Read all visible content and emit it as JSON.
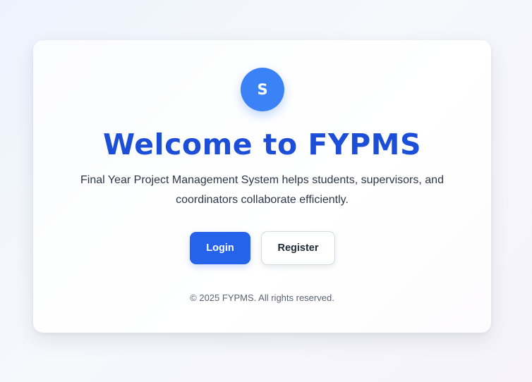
{
  "brand": {
    "avatar_letter": "S",
    "title": "Welcome to FYPMS",
    "description": "Final Year Project Management System helps students, supervisors, and coordinators collaborate efficiently."
  },
  "actions": {
    "login_label": "Login",
    "register_label": "Register"
  },
  "footer": {
    "copyright": "© 2025 FYPMS. All rights reserved."
  },
  "colors": {
    "primary": "#2563eb",
    "title": "#1d4ed8",
    "avatar": "#3b82f6",
    "background": "#f4f7fc"
  }
}
